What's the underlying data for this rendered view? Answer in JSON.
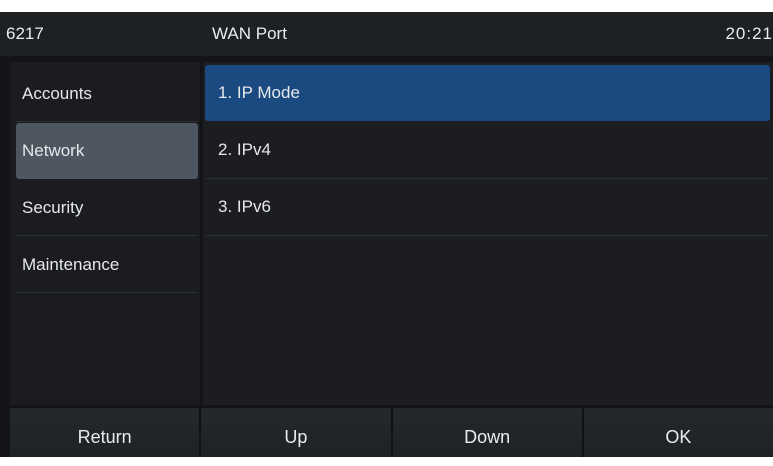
{
  "statusbar": {
    "extension": "6217",
    "title": "WAN Port",
    "time": "20:21"
  },
  "sidebar": {
    "items": [
      {
        "label": "Accounts"
      },
      {
        "label": "Network"
      },
      {
        "label": "Security"
      },
      {
        "label": "Maintenance"
      }
    ],
    "active_index": 1
  },
  "menu": {
    "items": [
      {
        "label": "1.  IP Mode"
      },
      {
        "label": "2.  IPv4"
      },
      {
        "label": "3.  IPv6"
      }
    ],
    "selected_index": 0
  },
  "softkeys": {
    "return_label": "Return",
    "up_label": "Up",
    "down_label": "Down",
    "ok_label": "OK"
  },
  "colors": {
    "selected_item": "#1a4a80",
    "active_sidebar": "#4d5661",
    "background": "#121417"
  }
}
